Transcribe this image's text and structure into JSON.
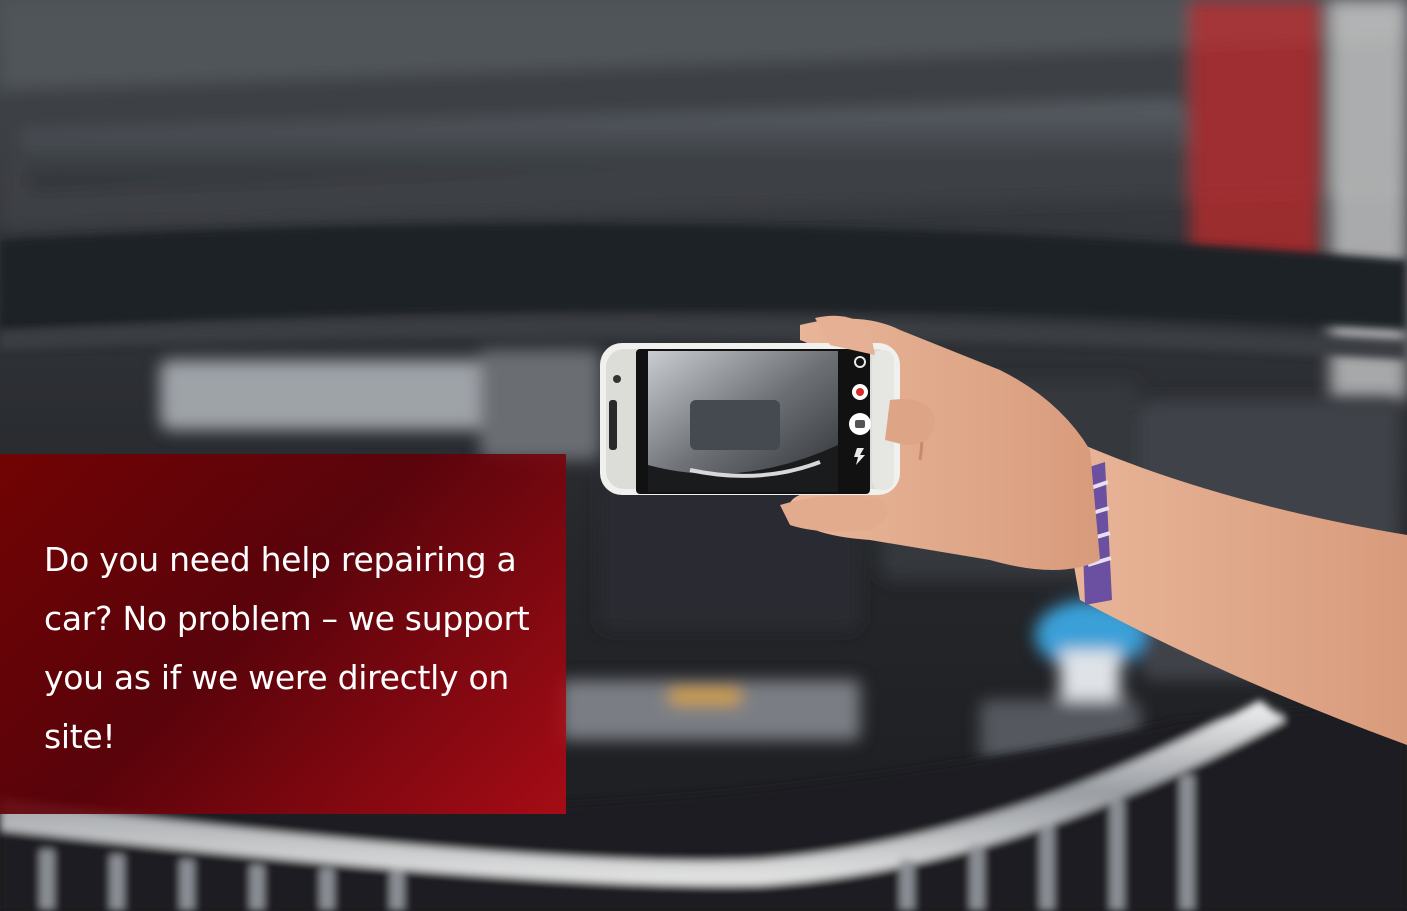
{
  "photo": {
    "subject": "hand-holding-phone-filming-engine-bay",
    "colors": {
      "background": "#2a2c30",
      "caption_box": "#7a0006",
      "caption_text": "#ffffff",
      "wristband": "#6b4fa0",
      "coolant_cap": "#3aa0d8"
    }
  },
  "phone_screen": {
    "icons": [
      "record-icon",
      "camera-shutter-icon",
      "flash-icon",
      "settings-icon"
    ]
  },
  "caption": {
    "text": "Do you need help repairing a car? No problem – we support you as if we were directly on site!"
  }
}
